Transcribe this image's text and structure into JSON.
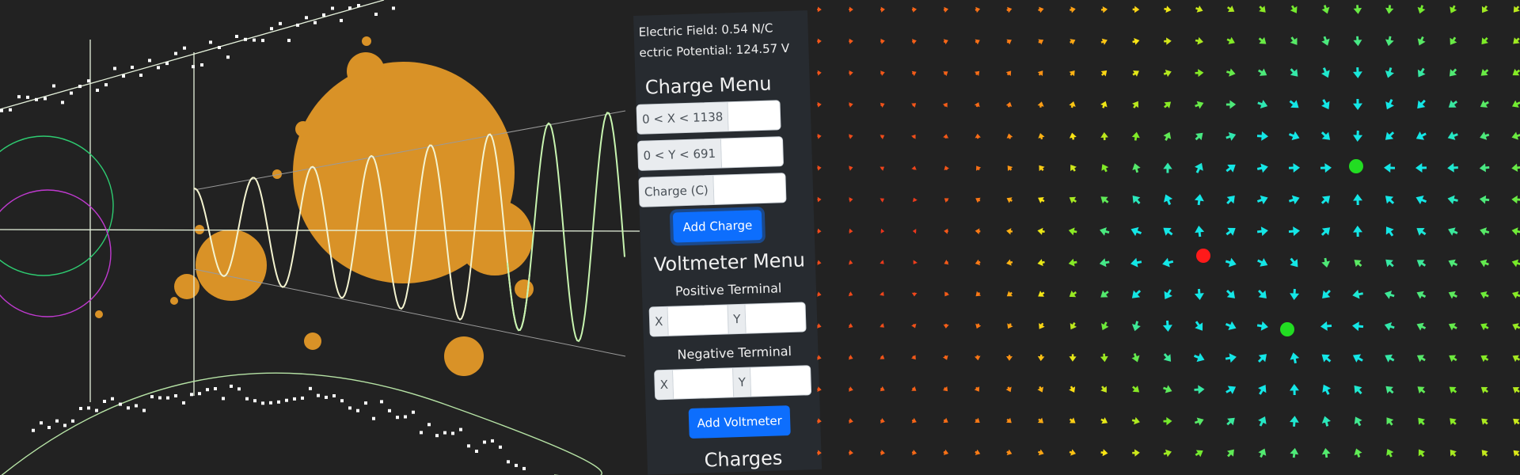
{
  "colors": {
    "background": "#222222",
    "fractal": "#d99227",
    "panel": "#272b30",
    "button": "#0d6efd",
    "positive_charge": "#ff1a1a",
    "negative_charge": "#22dd22",
    "wave": "#f4f4d0",
    "wave_tail": "#c8f5b0"
  },
  "readouts": {
    "electric_field": "Electric Field: 0.54 N/C",
    "electric_potential": "ectric Potential: 124.57 V"
  },
  "charge_menu": {
    "title": "Charge Menu",
    "x_label": "0 < X < 1138",
    "y_label": "0 < Y < 691",
    "charge_label": "Charge (C)",
    "x_value": "",
    "y_value": "",
    "charge_value": "",
    "add_button": "Add Charge"
  },
  "voltmeter_menu": {
    "title": "Voltmeter Menu",
    "positive_label": "Positive Terminal",
    "negative_label": "Negative Terminal",
    "x_addon": "X",
    "y_addon": "Y",
    "pos_x_value": "",
    "pos_y_value": "",
    "neg_x_value": "",
    "neg_y_value": "",
    "add_button": "Add Voltmeter"
  },
  "charges_heading": "Charges"
}
